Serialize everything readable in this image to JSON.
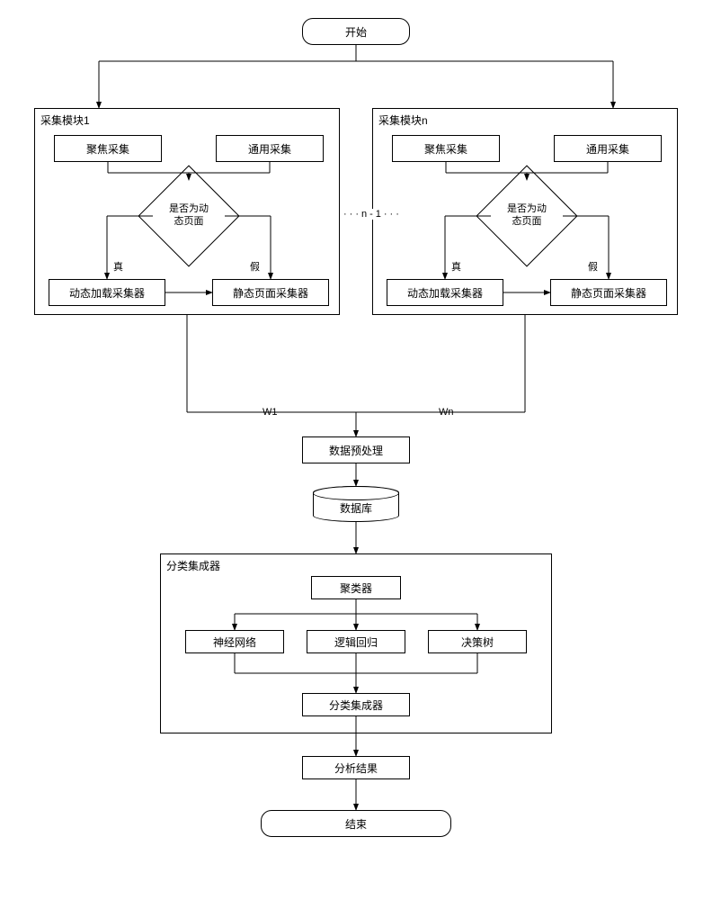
{
  "chart_data": {
    "type": "flowchart",
    "nodes": [
      {
        "id": "start",
        "label": "开始",
        "shape": "rounded-rect"
      },
      {
        "id": "mod1",
        "label": "采集模块1",
        "shape": "container"
      },
      {
        "id": "modn",
        "label": "采集模块n",
        "shape": "container"
      },
      {
        "id": "focus1",
        "label": "聚焦采集",
        "shape": "rect",
        "parent": "mod1"
      },
      {
        "id": "gen1",
        "label": "通用采集",
        "shape": "rect",
        "parent": "mod1"
      },
      {
        "id": "dyn1",
        "label": "是否为动\n态页面",
        "shape": "diamond",
        "parent": "mod1"
      },
      {
        "id": "dload1",
        "label": "动态加载采集器",
        "shape": "rect",
        "parent": "mod1"
      },
      {
        "id": "static1",
        "label": "静态页面采集器",
        "shape": "rect",
        "parent": "mod1"
      },
      {
        "id": "focusn",
        "label": "聚焦采集",
        "shape": "rect",
        "parent": "modn"
      },
      {
        "id": "genn",
        "label": "通用采集",
        "shape": "rect",
        "parent": "modn"
      },
      {
        "id": "dynn",
        "label": "是否为动\n态页面",
        "shape": "diamond",
        "parent": "modn"
      },
      {
        "id": "dloadn",
        "label": "动态加载采集器",
        "shape": "rect",
        "parent": "modn"
      },
      {
        "id": "staticn",
        "label": "静态页面采集器",
        "shape": "rect",
        "parent": "modn"
      },
      {
        "id": "preproc",
        "label": "数据预处理",
        "shape": "rect"
      },
      {
        "id": "db",
        "label": "数据库",
        "shape": "cylinder"
      },
      {
        "id": "clsbox",
        "label": "分类集成器",
        "shape": "container"
      },
      {
        "id": "cluster",
        "label": "聚类器",
        "shape": "rect",
        "parent": "clsbox"
      },
      {
        "id": "nn",
        "label": "神经网络",
        "shape": "rect",
        "parent": "clsbox"
      },
      {
        "id": "lr",
        "label": "逻辑回归",
        "shape": "rect",
        "parent": "clsbox"
      },
      {
        "id": "dt",
        "label": "决策树",
        "shape": "rect",
        "parent": "clsbox"
      },
      {
        "id": "ens",
        "label": "分类集成器",
        "shape": "rect",
        "parent": "clsbox"
      },
      {
        "id": "result",
        "label": "分析结果",
        "shape": "rect"
      },
      {
        "id": "end",
        "label": "结束",
        "shape": "rounded-rect"
      }
    ],
    "edges": [
      {
        "from": "start",
        "to": "mod1"
      },
      {
        "from": "start",
        "to": "modn"
      },
      {
        "from": "focus1",
        "to": "dyn1"
      },
      {
        "from": "gen1",
        "to": "dyn1"
      },
      {
        "from": "dyn1",
        "to": "dload1",
        "label": "真"
      },
      {
        "from": "dyn1",
        "to": "static1",
        "label": "假"
      },
      {
        "from": "dload1",
        "to": "static1"
      },
      {
        "from": "focusn",
        "to": "dynn"
      },
      {
        "from": "genn",
        "to": "dynn"
      },
      {
        "from": "dynn",
        "to": "dloadn",
        "label": "真"
      },
      {
        "from": "dynn",
        "to": "staticn",
        "label": "假"
      },
      {
        "from": "dloadn",
        "to": "staticn"
      },
      {
        "from": "mod1",
        "to": "preproc",
        "label": "W1"
      },
      {
        "from": "modn",
        "to": "preproc",
        "label": "Wn"
      },
      {
        "from": "preproc",
        "to": "db"
      },
      {
        "from": "db",
        "to": "clsbox"
      },
      {
        "from": "cluster",
        "to": "nn"
      },
      {
        "from": "cluster",
        "to": "lr"
      },
      {
        "from": "cluster",
        "to": "dt"
      },
      {
        "from": "nn",
        "to": "ens"
      },
      {
        "from": "lr",
        "to": "ens"
      },
      {
        "from": "dt",
        "to": "ens"
      },
      {
        "from": "ens",
        "to": "result"
      },
      {
        "from": "result",
        "to": "end"
      }
    ],
    "ellipsis_between_modules": "n-1"
  },
  "labels": {
    "start": "开始",
    "mod1": "采集模块1",
    "modn": "采集模块n",
    "focus": "聚焦采集",
    "general": "通用采集",
    "dynq": "是否为动<br>态页面",
    "dynq_plain": "是否为动\n态页面",
    "true": "真",
    "false": "假",
    "dynloader": "动态加载采集器",
    "staticcol": "静态页面采集器",
    "nminus1": "n-1",
    "w1": "W1",
    "wn": "Wn",
    "preproc": "数据预处理",
    "db": "数据库",
    "clsbox": "分类集成器",
    "cluster": "聚类器",
    "nn": "神经网络",
    "lr": "逻辑回归",
    "dt": "决策树",
    "ens": "分类集成器",
    "result": "分析结果",
    "end": "结束"
  }
}
